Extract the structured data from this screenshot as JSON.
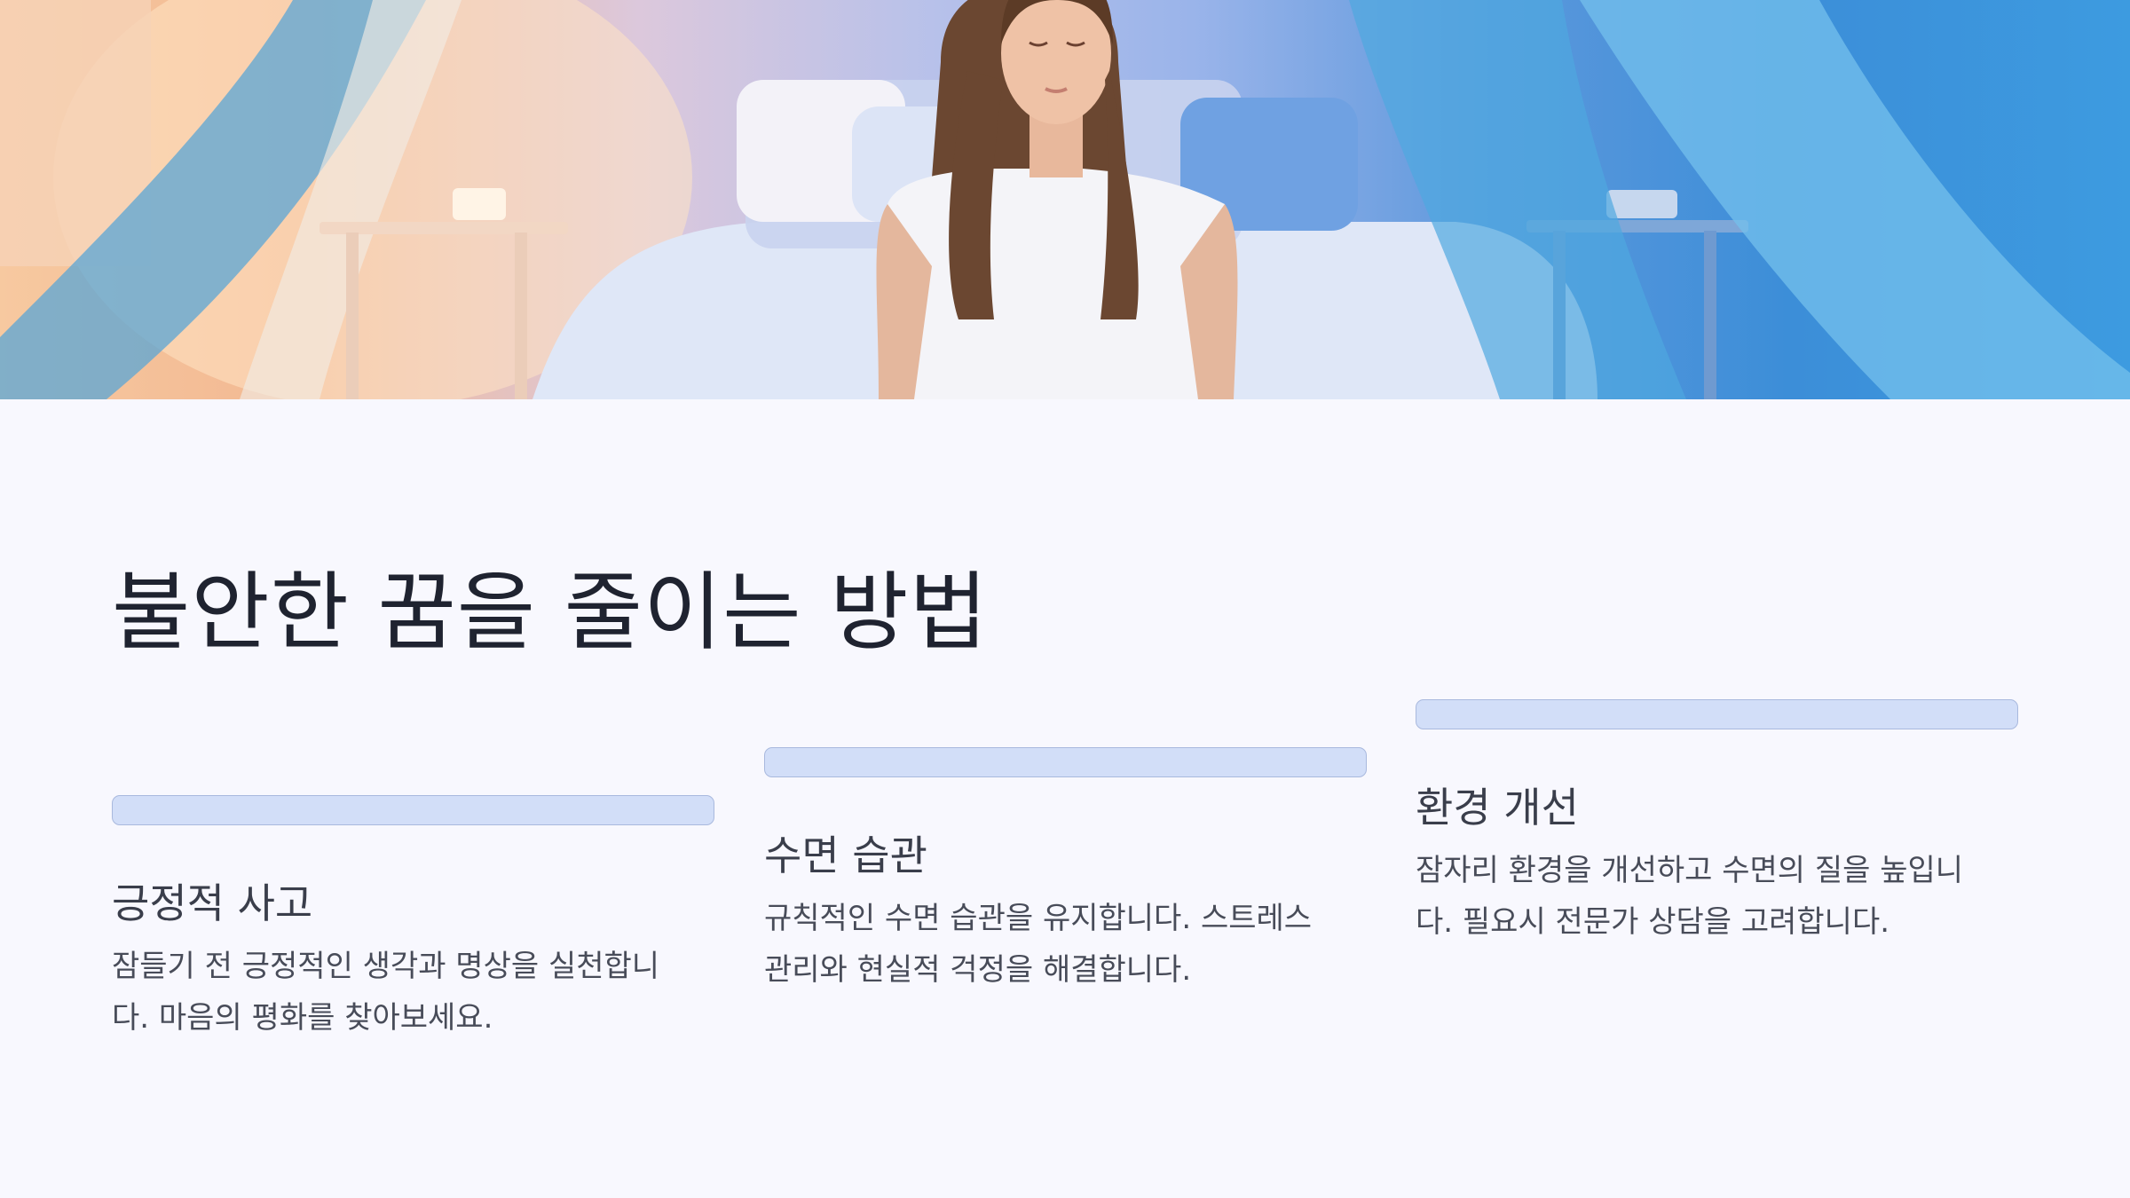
{
  "hero": {
    "image": "woman-meditating-on-bed-with-canopy-curtains"
  },
  "title": "불안한 꿈을 줄이는 방법",
  "cards": [
    {
      "heading": "긍정적 사고",
      "body_line1": "잠들기 전 긍정적인 생각과 명상을 실천합니",
      "body_line2": "다. 마음의 평화를 찾아보세요."
    },
    {
      "heading": "수면 습관",
      "body_line1": "규칙적인 수면 습관을 유지합니다. 스트레스",
      "body_line2": "관리와 현실적 걱정을 해결합니다."
    },
    {
      "heading": "환경 개선",
      "body_line1": "잠자리 환경을 개선하고 수면의 질을 높입니",
      "body_line2": "다. 필요시 전문가 상담을 고려합니다."
    }
  ],
  "colors": {
    "background": "#f8f8fe",
    "bar": "#d2def8",
    "bar_border": "#a9b9de",
    "title": "#1f2330"
  }
}
